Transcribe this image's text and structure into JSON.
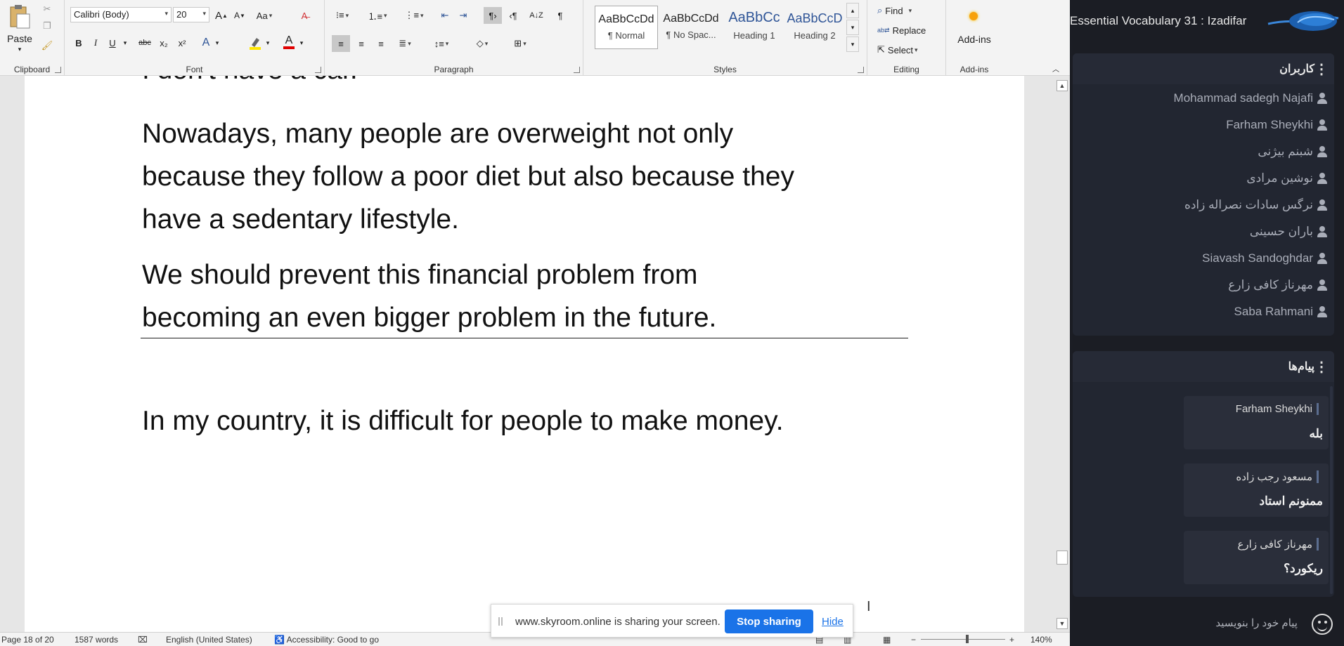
{
  "word": {
    "clipboard": {
      "paste_label": "Paste",
      "group_label": "Clipboard"
    },
    "font": {
      "font_name": "Calibri (Body)",
      "font_size": "20",
      "group_label": "Font",
      "change_case": "Aa",
      "bold": "B",
      "italic": "I",
      "underline": "U",
      "strike": "abc",
      "subscript": "x₂",
      "superscript": "x²",
      "grow": "A",
      "shrink": "A",
      "text_effects": "A",
      "font_color": "A"
    },
    "paragraph": {
      "group_label": "Paragraph",
      "pilcrow": "¶"
    },
    "styles": {
      "group_label": "Styles",
      "items": [
        {
          "sample": "AaBbCcDd",
          "name": "¶ Normal"
        },
        {
          "sample": "AaBbCcDd",
          "name": "¶ No Spac..."
        },
        {
          "sample": "AaBbCc",
          "name": "Heading 1"
        },
        {
          "sample": "AaBbCcD",
          "name": "Heading 2"
        }
      ]
    },
    "editing": {
      "group_label": "Editing",
      "find": "Find",
      "replace": "Replace",
      "select": "Select"
    },
    "addins": {
      "group_label": "Add-ins",
      "label": "Add-ins"
    },
    "document": {
      "cut_line": "I don't have a car.",
      "paragraphs": [
        "Nowadays, many people are overweight not only because they follow a poor diet but also because they have a sedentary lifestyle.",
        "We should prevent this financial problem from becoming an even bigger problem in the future."
      ],
      "last_paragraph": "In my country, it is difficult for people to make money."
    },
    "status": {
      "page": "Page 18 of 20",
      "words": "1587 words",
      "language": "English (United States)",
      "accessibility": "Accessibility: Good to go",
      "zoom": "140%"
    }
  },
  "share_bar": {
    "text": "www.skyroom.online is sharing your screen.",
    "stop_label": "Stop sharing",
    "hide_label": "Hide"
  },
  "skyroom": {
    "room_title": "Essential Vocabulary 31 : Izadifar",
    "users_panel": {
      "title": "کاربران",
      "users": [
        "Mohammad sadegh Najafi",
        "Farham Sheykhi",
        "شبنم بیژنی",
        "نوشین مرادی",
        "نرگس سادات نصراله زاده",
        "باران حسینی",
        "Siavash Sandoghdar",
        "مهرناز کافی زارع",
        "Saba Rahmani"
      ]
    },
    "messages_panel": {
      "title": "پیام‌ها",
      "messages": [
        {
          "author": "Farham Sheykhi",
          "text": "بله"
        },
        {
          "author": "مسعود رجب زاده",
          "text": "ممنونم استاد"
        },
        {
          "author": "مهرناز کافی زارع",
          "text": "ریکورد؟"
        }
      ]
    },
    "chat_placeholder": "پیام خود را بنویسید"
  }
}
